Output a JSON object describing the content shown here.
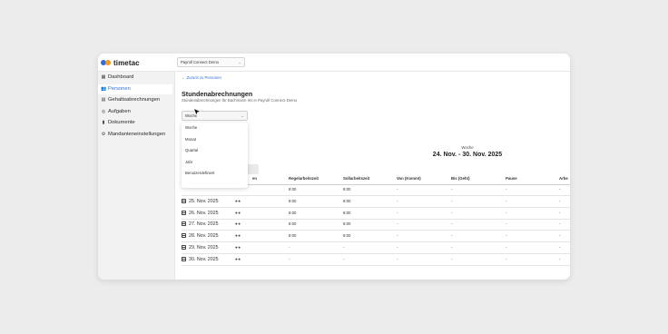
{
  "app": {
    "brand": "timetac",
    "company_selector": "Payroll Connect Demo"
  },
  "sidebar": {
    "items": [
      {
        "label": "Dashboard",
        "icon": "grid-icon"
      },
      {
        "label": "Personen",
        "icon": "people-icon",
        "active": true
      },
      {
        "label": "Gehaltsabrechnungen",
        "icon": "table-icon"
      },
      {
        "label": "Aufgaben",
        "icon": "check-circle-icon"
      },
      {
        "label": "Dokumente",
        "icon": "document-icon"
      },
      {
        "label": "Mandanteneinstellungen",
        "icon": "gear-icon"
      }
    ]
  },
  "main": {
    "back_link": "← Zurück zu Personen",
    "title": "Stundenabrechnungen",
    "subtitle": "Stundenabrechnungen für Bachmann Iris in Payroll Connect Demo",
    "period_select": {
      "value": "Woche",
      "options": [
        "Woche",
        "Monat",
        "Quartal",
        "Jahr",
        "Benutzerdefiniert"
      ]
    },
    "week_label": "Woche",
    "week_range": "24. Nov. - 30. Nov. 2025",
    "hidden_button_fragment": "n"
  },
  "table": {
    "columns": [
      "en",
      "Regelarbeitszeit",
      "Sollarbeitszeit",
      "Von (Kommt)",
      "Bis (Geht)",
      "Pause",
      "Arbe"
    ],
    "rows": [
      {
        "date": "",
        "regel": "8:00",
        "soll": "8:00",
        "von": "-",
        "bis": "-",
        "pause": "-",
        "arbeit": "-"
      },
      {
        "date": "25. Nov. 2025",
        "regel": "8:00",
        "soll": "8:00",
        "von": "-",
        "bis": "-",
        "pause": "-",
        "arbeit": "-"
      },
      {
        "date": "26. Nov. 2025",
        "regel": "8:00",
        "soll": "8:00",
        "von": "-",
        "bis": "-",
        "pause": "-",
        "arbeit": "-"
      },
      {
        "date": "27. Nov. 2025",
        "regel": "8:00",
        "soll": "8:00",
        "von": "-",
        "bis": "-",
        "pause": "-",
        "arbeit": "-"
      },
      {
        "date": "28. Nov. 2025",
        "regel": "8:00",
        "soll": "8:00",
        "von": "-",
        "bis": "-",
        "pause": "-",
        "arbeit": "-"
      },
      {
        "date": "29. Nov. 2025",
        "regel": "-",
        "soll": "-",
        "von": "-",
        "bis": "-",
        "pause": "-",
        "arbeit": "-"
      },
      {
        "date": "30. Nov. 2025",
        "regel": "-",
        "soll": "-",
        "von": "-",
        "bis": "-",
        "pause": "-",
        "arbeit": "-"
      }
    ]
  },
  "colors": {
    "accent": "#2f6de1",
    "brand_dot_secondary": "#f59a23",
    "sidebar_bg": "#f2f2f2",
    "page_bg": "#ececec"
  }
}
